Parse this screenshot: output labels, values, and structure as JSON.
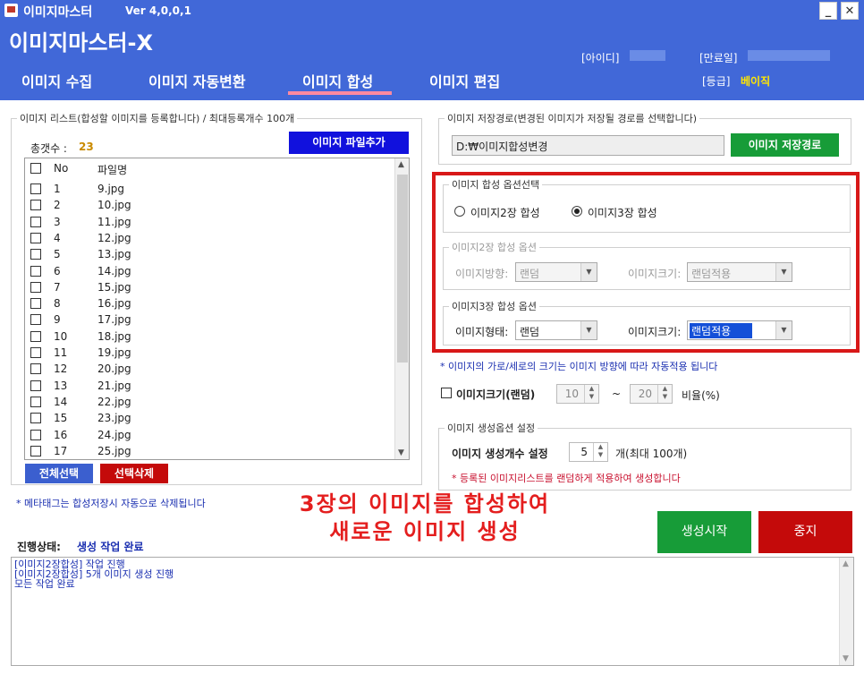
{
  "window": {
    "title": "이미지마스터",
    "version": "Ver 4,0,0,1",
    "minimize": "_",
    "close": "✕"
  },
  "header": {
    "app_title": "이미지마스터-X",
    "id_label": "[아이디]",
    "expiry_label": "[만료일]",
    "grade_label": "[등급]",
    "grade_value": "베이직"
  },
  "tabs": [
    {
      "label": "이미지 수집",
      "active": false
    },
    {
      "label": "이미지 자동변환",
      "active": false
    },
    {
      "label": "이미지 합성",
      "active": true
    },
    {
      "label": "이미지 편집",
      "active": false
    }
  ],
  "image_list": {
    "legend": "이미지 리스트(합성할 이미지를 등록합니다) / 최대등록개수 100개",
    "total_label": "총갯수 :",
    "total_count": "23",
    "add_button": "이미지 파일추가",
    "columns": [
      "No",
      "파일명"
    ],
    "rows": [
      {
        "no": "1",
        "file": "9.jpg"
      },
      {
        "no": "2",
        "file": "10.jpg"
      },
      {
        "no": "3",
        "file": "11.jpg"
      },
      {
        "no": "4",
        "file": "12.jpg"
      },
      {
        "no": "5",
        "file": "13.jpg"
      },
      {
        "no": "6",
        "file": "14.jpg"
      },
      {
        "no": "7",
        "file": "15.jpg"
      },
      {
        "no": "8",
        "file": "16.jpg"
      },
      {
        "no": "9",
        "file": "17.jpg"
      },
      {
        "no": "10",
        "file": "18.jpg"
      },
      {
        "no": "11",
        "file": "19.jpg"
      },
      {
        "no": "12",
        "file": "20.jpg"
      },
      {
        "no": "13",
        "file": "21.jpg"
      },
      {
        "no": "14",
        "file": "22.jpg"
      },
      {
        "no": "15",
        "file": "23.jpg"
      },
      {
        "no": "16",
        "file": "24.jpg"
      },
      {
        "no": "17",
        "file": "25.jpg"
      }
    ],
    "select_all_button": "전체선택",
    "delete_button": "선택삭제",
    "meta_note": "* 메타태그는 합성저장시 자동으로 삭제됩니다"
  },
  "save_path": {
    "legend": "이미지 저장경로(변경된 이미지가 저장될 경로를 선택합니다)",
    "value": "D:₩이미지합성변경",
    "button": "이미지 저장경로"
  },
  "compose_options": {
    "legend": "이미지 합성 옵션선택",
    "radio_2": "이미지2장 합성",
    "radio_3": "이미지3장 합성",
    "selected": "3"
  },
  "two_image_options": {
    "legend": "이미지2장 합성 옵션",
    "direction_label": "이미지방향:",
    "direction_value": "랜덤",
    "size_label": "이미지크기:",
    "size_value": "랜덤적용"
  },
  "three_image_options": {
    "legend": "이미지3장 합성 옵션",
    "shape_label": "이미지형태:",
    "shape_value": "랜덤",
    "size_label": "이미지크기:",
    "size_value": "랜덤적용"
  },
  "size_note": "* 이미지의 가로/세로의 크기는 이미지 방향에 따라 자동적용 됩니다",
  "random_size": {
    "label": "이미지크기(랜덤)",
    "min": "10",
    "tilde": "~",
    "max": "20",
    "unit": "비율(%)"
  },
  "generation": {
    "legend": "이미지 생성옵션 설정",
    "count_label": "이미지 생성개수 설정",
    "count_value": "5",
    "count_hint": "개(최대 100개)",
    "note": "* 등록된 이미지리스트를 랜덤하게 적용하여 생성합니다"
  },
  "overlay": {
    "line1": "3장의 이미지를 합성하여",
    "line2": "새로운 이미지 생성"
  },
  "actions": {
    "start": "생성시작",
    "stop": "중지"
  },
  "status": {
    "label": "진행상태:",
    "value": "생성 작업 완료"
  },
  "log": [
    "[이미지2장합성] 작업 진행",
    "[이미지2장합성] 5개 이미지 생성 진행",
    "모든 작업 완료"
  ],
  "colors": {
    "header_blue": "#4168d8",
    "highlight_red": "#d81818",
    "button_green": "#179c38",
    "button_red": "#c40a0a",
    "button_blue": "#1111dd"
  }
}
